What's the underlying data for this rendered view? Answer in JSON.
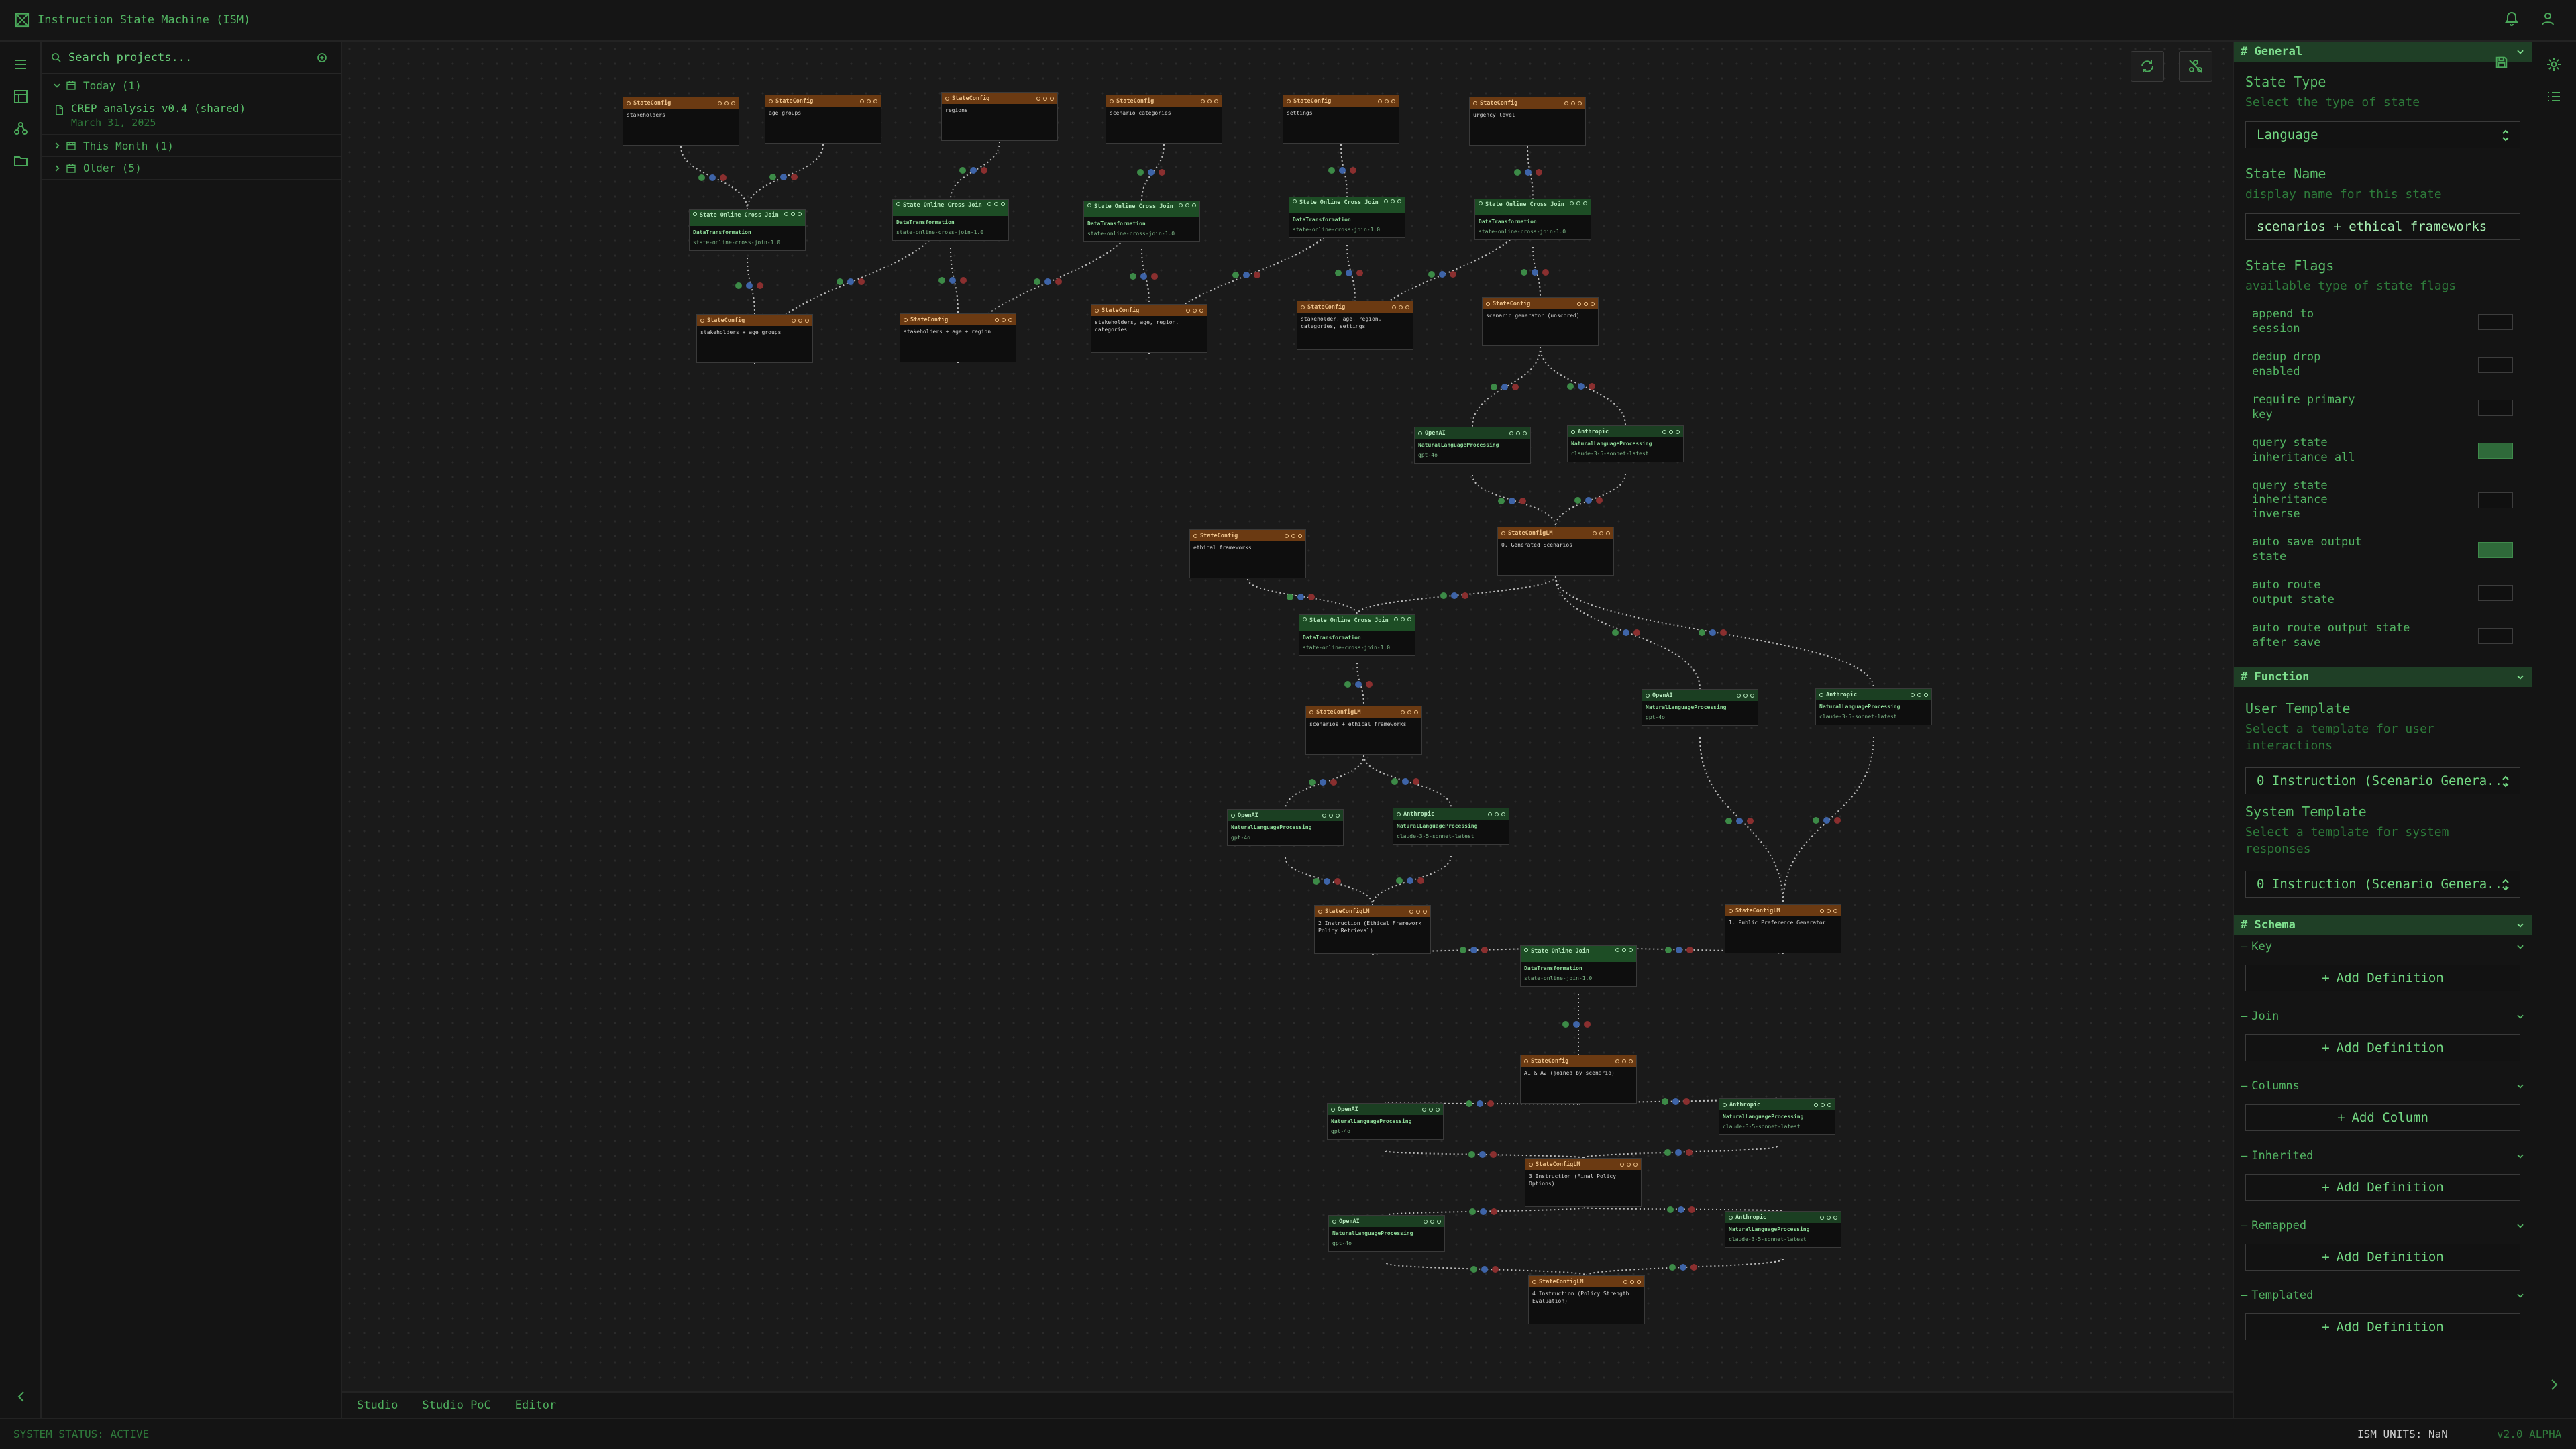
{
  "app": {
    "title": "Instruction State Machine (ISM)"
  },
  "sidebar": {
    "search_placeholder": "Search projects...",
    "groups": [
      {
        "label": "Today (1)"
      },
      {
        "label": "This Month (1)"
      },
      {
        "label": "Older (5)"
      }
    ],
    "project": {
      "name": "CREP analysis v0.4 (shared)",
      "date": "March 31, 2025"
    }
  },
  "canvas": {
    "nodes": [
      {
        "kind": "cfg",
        "title": "StateConfig",
        "body": "stakeholders"
      },
      {
        "kind": "cfg",
        "title": "StateConfig",
        "body": "age groups"
      },
      {
        "kind": "cfg",
        "title": "StateConfig",
        "body": "regions"
      },
      {
        "kind": "cfg",
        "title": "StateConfig",
        "body": "scenario categories"
      },
      {
        "kind": "cfg",
        "title": "StateConfig",
        "body": "settings"
      },
      {
        "kind": "cfg",
        "title": "StateConfig",
        "body": "urgency level"
      },
      {
        "kind": "join",
        "title": "State Online Cross Join",
        "fn": "DataTransformation",
        "sub": "state-online-cross-join-1.0"
      },
      {
        "kind": "join",
        "title": "State Online Cross Join",
        "fn": "DataTransformation",
        "sub": "state-online-cross-join-1.0"
      },
      {
        "kind": "join",
        "title": "State Online Cross Join",
        "fn": "DataTransformation",
        "sub": "state-online-cross-join-1.0"
      },
      {
        "kind": "join",
        "title": "State Online Cross Join",
        "fn": "DataTransformation",
        "sub": "state-online-cross-join-1.0"
      },
      {
        "kind": "join",
        "title": "State Online Cross Join",
        "fn": "DataTransformation",
        "sub": "state-online-cross-join-1.0"
      },
      {
        "kind": "cfg",
        "title": "StateConfig",
        "body": "stakeholders + age groups"
      },
      {
        "kind": "cfg",
        "title": "StateConfig",
        "body": "stakeholders + age + region"
      },
      {
        "kind": "cfg",
        "title": "StateConfig",
        "body": "stakeholders, age, region, categories"
      },
      {
        "kind": "cfg",
        "title": "StateConfig",
        "body": "stakeholder, age, region, categories, settings"
      },
      {
        "kind": "cfg",
        "title": "StateConfig",
        "body": "scenario generator (unscored)"
      },
      {
        "kind": "llm",
        "title": "OpenAI",
        "fn": "NaturalLanguageProcessing",
        "sub": "gpt-4o"
      },
      {
        "kind": "llm",
        "title": "Anthropic",
        "fn": "NaturalLanguageProcessing",
        "sub": "claude-3-5-sonnet-latest"
      },
      {
        "kind": "cfg",
        "title": "StateConfig",
        "body": "ethical frameworks"
      },
      {
        "kind": "cfg",
        "title": "StateConfigLM",
        "body": "0. Generated Scenarios"
      },
      {
        "kind": "join",
        "title": "State Online Cross Join",
        "fn": "DataTransformation",
        "sub": "state-online-cross-join-1.0"
      },
      {
        "kind": "cfg",
        "title": "StateConfigLM",
        "body": "scenarios + ethical frameworks"
      },
      {
        "kind": "llm",
        "title": "OpenAI",
        "fn": "NaturalLanguageProcessing",
        "sub": "gpt-4o"
      },
      {
        "kind": "llm",
        "title": "Anthropic",
        "fn": "NaturalLanguageProcessing",
        "sub": "claude-3-5-sonnet-latest"
      },
      {
        "kind": "llm",
        "title": "OpenAI",
        "fn": "NaturalLanguageProcessing",
        "sub": "gpt-4o"
      },
      {
        "kind": "llm",
        "title": "Anthropic",
        "fn": "NaturalLanguageProcessing",
        "sub": "claude-3-5-sonnet-latest"
      },
      {
        "kind": "cfg",
        "title": "StateConfigLM",
        "body": "2 Instruction (Ethical Framework Policy Retrieval)"
      },
      {
        "kind": "join",
        "title": "State Online Join",
        "fn": "DataTransformation",
        "sub": "state-online-join-1.0"
      },
      {
        "kind": "cfg",
        "title": "StateConfigLM",
        "body": "1. Public Preference Generator"
      },
      {
        "kind": "cfg",
        "title": "StateConfig",
        "body": "A1 & A2 (joined by scenario)"
      },
      {
        "kind": "llm",
        "title": "OpenAI",
        "fn": "NaturalLanguageProcessing",
        "sub": "gpt-4o"
      },
      {
        "kind": "llm",
        "title": "Anthropic",
        "fn": "NaturalLanguageProcessing",
        "sub": "claude-3-5-sonnet-latest"
      },
      {
        "kind": "cfg",
        "title": "StateConfigLM",
        "body": "3 Instruction (Final Policy Options)"
      },
      {
        "kind": "llm",
        "title": "OpenAI",
        "fn": "NaturalLanguageProcessing",
        "sub": "gpt-4o"
      },
      {
        "kind": "llm",
        "title": "Anthropic",
        "fn": "NaturalLanguageProcessing",
        "sub": "claude-3-5-sonnet-latest"
      },
      {
        "kind": "cfg",
        "title": "StateConfigLM",
        "body": "4 Instruction (Policy Strength Evaluation)"
      }
    ]
  },
  "tabs": {
    "studio": "Studio",
    "studio_poc": "Studio PoC",
    "editor": "Editor"
  },
  "props": {
    "general": {
      "title": "# General",
      "state_type_label": "State Type",
      "state_type_help": "Select the type of state",
      "state_type_value": "Language",
      "state_name_label": "State Name",
      "state_name_help": "display name for this state",
      "state_name_value": "scenarios + ethical frameworks",
      "flags_label": "State Flags",
      "flags_help": "available type of state flags",
      "flags": [
        {
          "label": "append to session",
          "on": false
        },
        {
          "label": "dedup drop enabled",
          "on": false
        },
        {
          "label": "require primary key",
          "on": false
        },
        {
          "label": "query state inheritance all",
          "on": true
        },
        {
          "label": "query state inheritance inverse",
          "on": false
        },
        {
          "label": "auto save output state",
          "on": true
        },
        {
          "label": "auto route output state",
          "on": false
        },
        {
          "label": "auto route output state after save",
          "on": false
        }
      ]
    },
    "function": {
      "title": "# Function",
      "user_template_label": "User Template",
      "user_template_help": "Select a template for user interactions",
      "user_template_value": "0 Instruction (Scenario Genera...",
      "system_template_label": "System Template",
      "system_template_help": "Select a template for system responses",
      "system_template_value": "0 Instruction (Scenario Genera..."
    },
    "schema": {
      "title": "# Schema",
      "sections": [
        {
          "label": "Key",
          "button": "Add Definition"
        },
        {
          "label": "Join",
          "button": "Add Definition"
        },
        {
          "label": "Columns",
          "button": "Add Column"
        },
        {
          "label": "Inherited",
          "button": "Add Definition"
        },
        {
          "label": "Remapped",
          "button": "Add Definition"
        },
        {
          "label": "Templated",
          "button": "Add Definition"
        }
      ]
    }
  },
  "status": {
    "left": "SYSTEM STATUS: ACTIVE",
    "units": "ISM UNITS: NaN",
    "version": "v2.0 ALPHA"
  },
  "colors": {
    "accent": "#4aa85a",
    "node_header_config": "#6b3a12",
    "node_header_function": "#1d4d25",
    "edge": "#bdbdbd"
  }
}
